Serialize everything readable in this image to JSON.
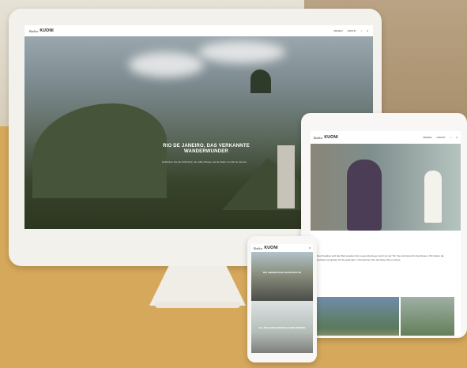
{
  "desktop": {
    "brand_script": "Badica",
    "brand_logo": "KUONI",
    "nav_right": [
      "REISEN",
      "GROUP"
    ],
    "hero_title": "RIO DE JANEIRO, DAS VERKANNTE WANDERWUNDER",
    "hero_subtitle": "Entdecken Sie die Schönheit, die wilden Berge und die Natur von Rio de Janeiro."
  },
  "tablet": {
    "brand_script": "Badica",
    "brand_logo": "KUONI",
    "nav_right": [
      "REISEN",
      "GROUP"
    ],
    "body_text": "Das Paradies wird die Welt erwartet: Ein neues Abenteuer steht vor der Tür. Sie sind bereit für das Reisen. Wir haben die perfekten Angebote für Sie gefunden. Unternehmen Sie die Reise Ihres Lebens."
  },
  "phone": {
    "brand_script": "Badica",
    "brand_logo": "KUONI",
    "caption1": "DIE UNENDLICHE ARCHITEKTUR",
    "caption2": "ALL INCLUSIVE REISEN IN DEN TROPEN"
  }
}
